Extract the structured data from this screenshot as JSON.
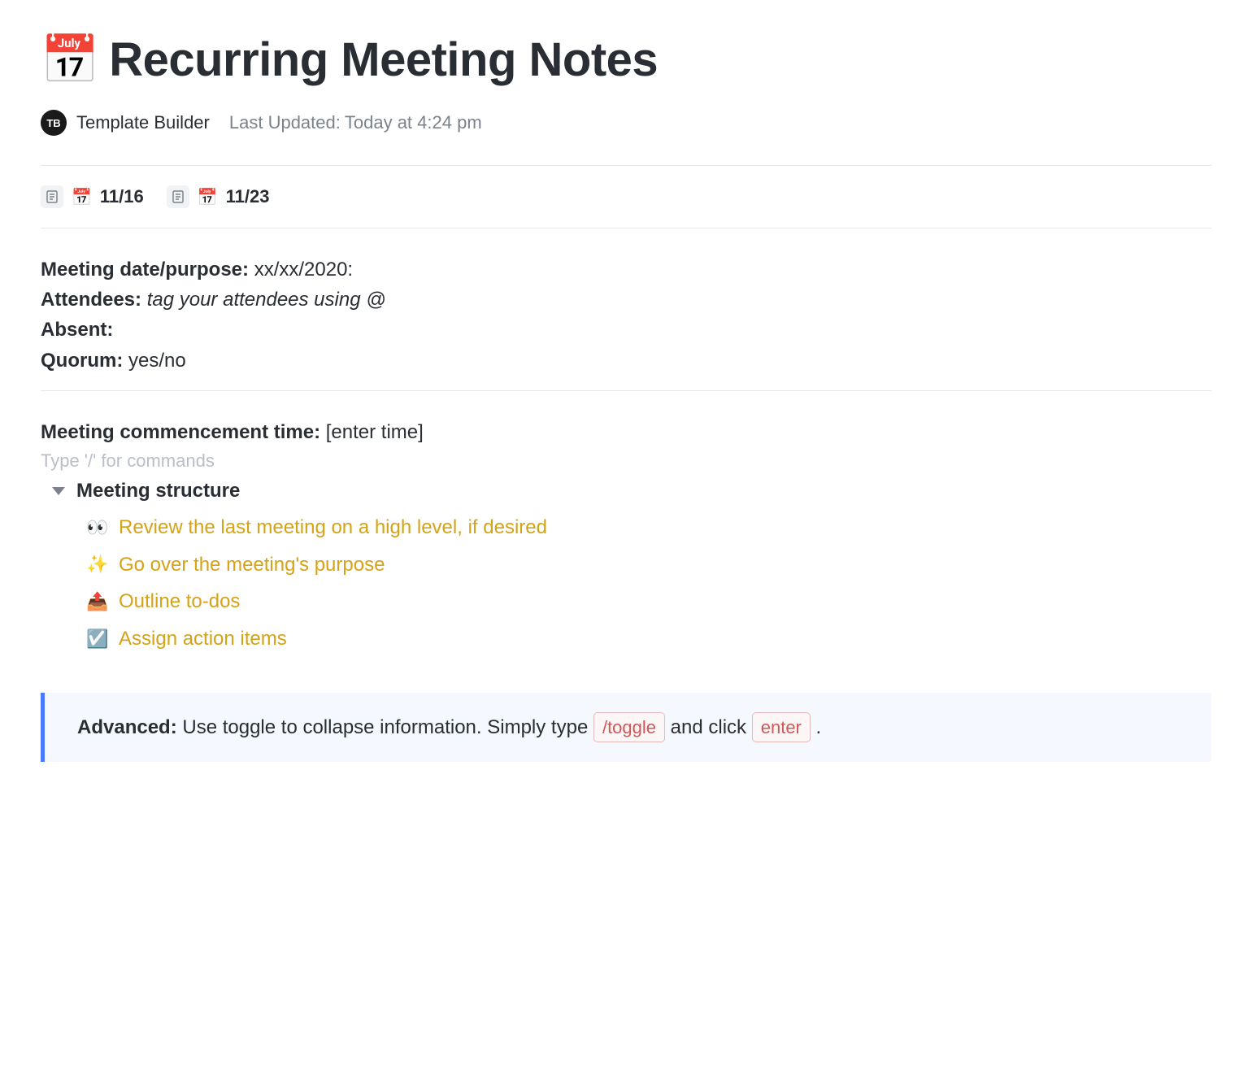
{
  "header": {
    "icon": "📅",
    "title": "Recurring Meeting Notes"
  },
  "meta": {
    "avatar_initials": "TB",
    "author": "Template Builder",
    "last_updated_label": "Last Updated:",
    "last_updated_value": "Today at 4:24 pm"
  },
  "date_links": [
    {
      "icon": "📅",
      "label": "11/16"
    },
    {
      "icon": "📅",
      "label": "11/23"
    }
  ],
  "info": {
    "meeting_date_label": "Meeting date/purpose:",
    "meeting_date_value": "xx/xx/2020:",
    "attendees_label": "Attendees:",
    "attendees_hint": "tag your attendees using @",
    "absent_label": "Absent:",
    "quorum_label": "Quorum:",
    "quorum_value": "yes/no"
  },
  "commencement": {
    "label": "Meeting commencement time:",
    "value": "[enter time]",
    "placeholder_hint": "Type '/' for commands"
  },
  "structure": {
    "title": "Meeting structure",
    "items": [
      {
        "emoji": "👀",
        "text": "Review the last meeting on a high level, if desired"
      },
      {
        "emoji": "✨",
        "text": "Go over the meeting's purpose"
      },
      {
        "emoji": "📤",
        "text": "Outline to-dos"
      },
      {
        "emoji": "☑️",
        "text": "Assign action items"
      }
    ]
  },
  "callout": {
    "label": "Advanced:",
    "text_before": " Use toggle to collapse information. Simply type ",
    "kbd1": "/toggle",
    "text_mid": " and click ",
    "kbd2": "enter",
    "text_after": " ."
  }
}
